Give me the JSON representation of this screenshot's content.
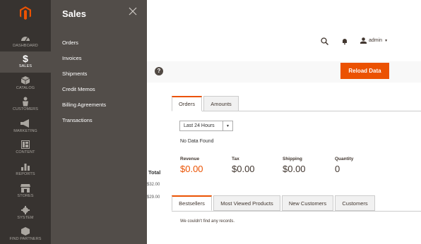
{
  "nav": {
    "items": [
      {
        "label": "DASHBOARD",
        "icon": "dashboard-icon"
      },
      {
        "label": "SALES",
        "icon": "dollar-icon"
      },
      {
        "label": "CATALOG",
        "icon": "catalog-icon"
      },
      {
        "label": "CUSTOMERS",
        "icon": "customers-icon"
      },
      {
        "label": "MARKETING",
        "icon": "megaphone-icon"
      },
      {
        "label": "CONTENT",
        "icon": "content-icon"
      },
      {
        "label": "REPORTS",
        "icon": "bar-chart-icon"
      },
      {
        "label": "STORES",
        "icon": "store-icon"
      },
      {
        "label": "SYSTEM",
        "icon": "gear-icon"
      },
      {
        "label": "FIND PARTNERS",
        "icon": "partners-icon"
      }
    ],
    "accent": "#eb5202"
  },
  "submenu": {
    "title": "Sales",
    "items": [
      "Orders",
      "Invoices",
      "Shipments",
      "Credit Memos",
      "Billing Agreements",
      "Transactions"
    ]
  },
  "header": {
    "user": "admin"
  },
  "toolbar": {
    "reload_label": "Reload Data",
    "help_glyph": "?"
  },
  "left_table": {
    "header": "Total",
    "values": [
      "$32.00",
      "$29.00"
    ]
  },
  "chart_tabs": [
    "Orders",
    "Amounts"
  ],
  "period": {
    "selected": "Last 24 Hours"
  },
  "chart_message": "No Data Found",
  "totals": [
    {
      "label": "Revenue",
      "value": "$0.00"
    },
    {
      "label": "Tax",
      "value": "$0.00"
    },
    {
      "label": "Shipping",
      "value": "$0.00"
    },
    {
      "label": "Quantity",
      "value": "0"
    }
  ],
  "grid_tabs": [
    "Bestsellers",
    "Most Viewed Products",
    "New Customers",
    "Customers"
  ],
  "grid_message": "We couldn't find any records."
}
